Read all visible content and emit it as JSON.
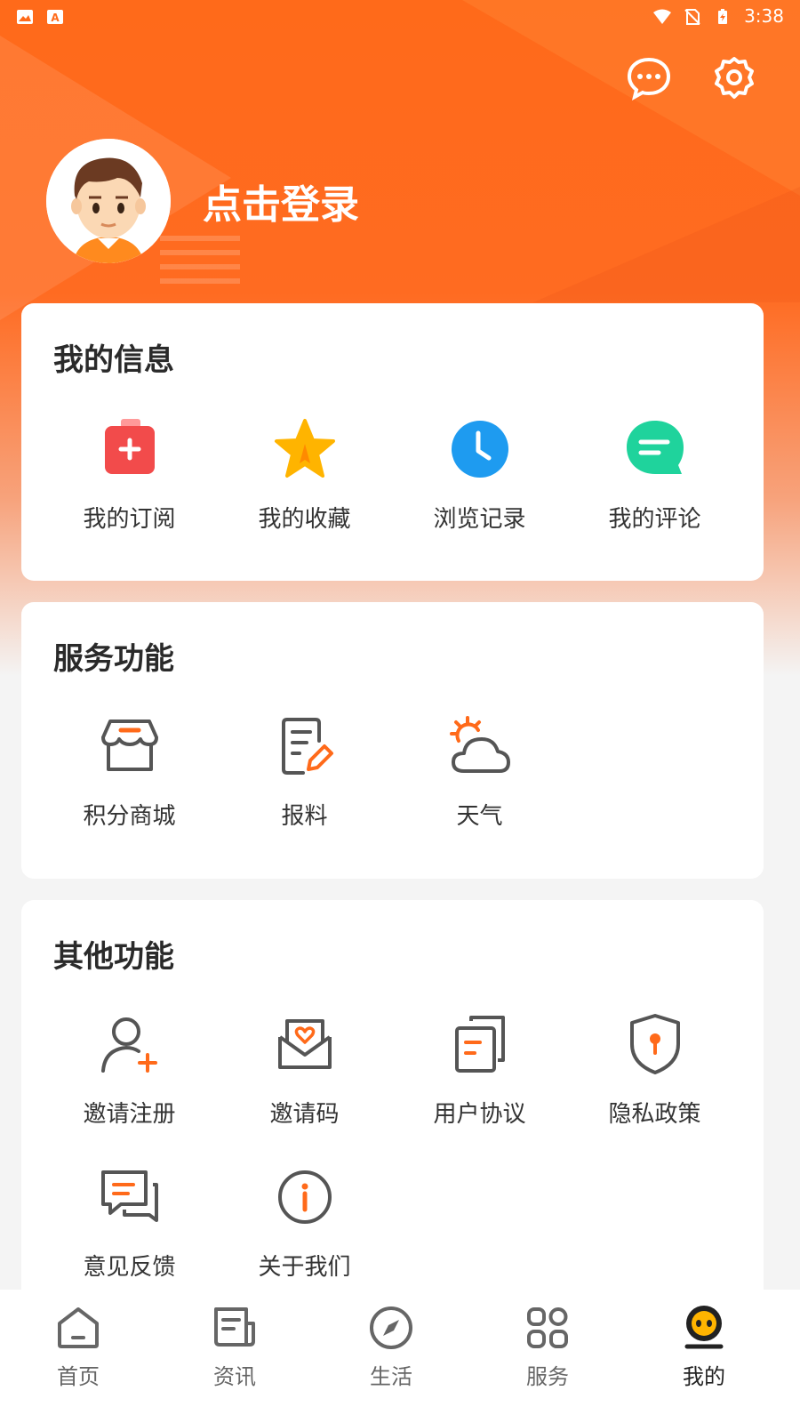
{
  "status_bar": {
    "time": "3:38"
  },
  "header": {
    "login_label": "点击登录",
    "icons": [
      "message-icon",
      "settings-icon"
    ]
  },
  "my_info": {
    "title": "我的信息",
    "items": [
      {
        "label": "我的订阅",
        "icon": "subscription-icon",
        "color": "#f24b4b"
      },
      {
        "label": "我的收藏",
        "icon": "star-icon",
        "color": "#ffb400"
      },
      {
        "label": "浏览记录",
        "icon": "clock-icon",
        "color": "#1e9bf0"
      },
      {
        "label": "我的评论",
        "icon": "comment-icon",
        "color": "#1fd39c"
      }
    ]
  },
  "services": {
    "title": "服务功能",
    "items": [
      {
        "label": "积分商城",
        "icon": "store-icon"
      },
      {
        "label": "报料",
        "icon": "report-edit-icon"
      },
      {
        "label": "天气",
        "icon": "weather-icon"
      }
    ]
  },
  "other": {
    "title": "其他功能",
    "items": [
      {
        "label": "邀请注册",
        "icon": "invite-user-icon"
      },
      {
        "label": "邀请码",
        "icon": "invite-code-icon"
      },
      {
        "label": "用户协议",
        "icon": "agreement-icon"
      },
      {
        "label": "隐私政策",
        "icon": "privacy-shield-icon"
      },
      {
        "label": "意见反馈",
        "icon": "feedback-icon"
      },
      {
        "label": "关于我们",
        "icon": "about-icon"
      }
    ]
  },
  "bottom_nav": {
    "items": [
      {
        "label": "首页",
        "icon": "home-icon"
      },
      {
        "label": "资讯",
        "icon": "news-icon"
      },
      {
        "label": "生活",
        "icon": "compass-icon"
      },
      {
        "label": "服务",
        "icon": "apps-icon"
      },
      {
        "label": "我的",
        "icon": "profile-icon",
        "active": true
      }
    ]
  },
  "colors": {
    "accent": "#ff6a1a",
    "icon_orange": "#ff6a1a",
    "icon_gray": "#555555"
  }
}
